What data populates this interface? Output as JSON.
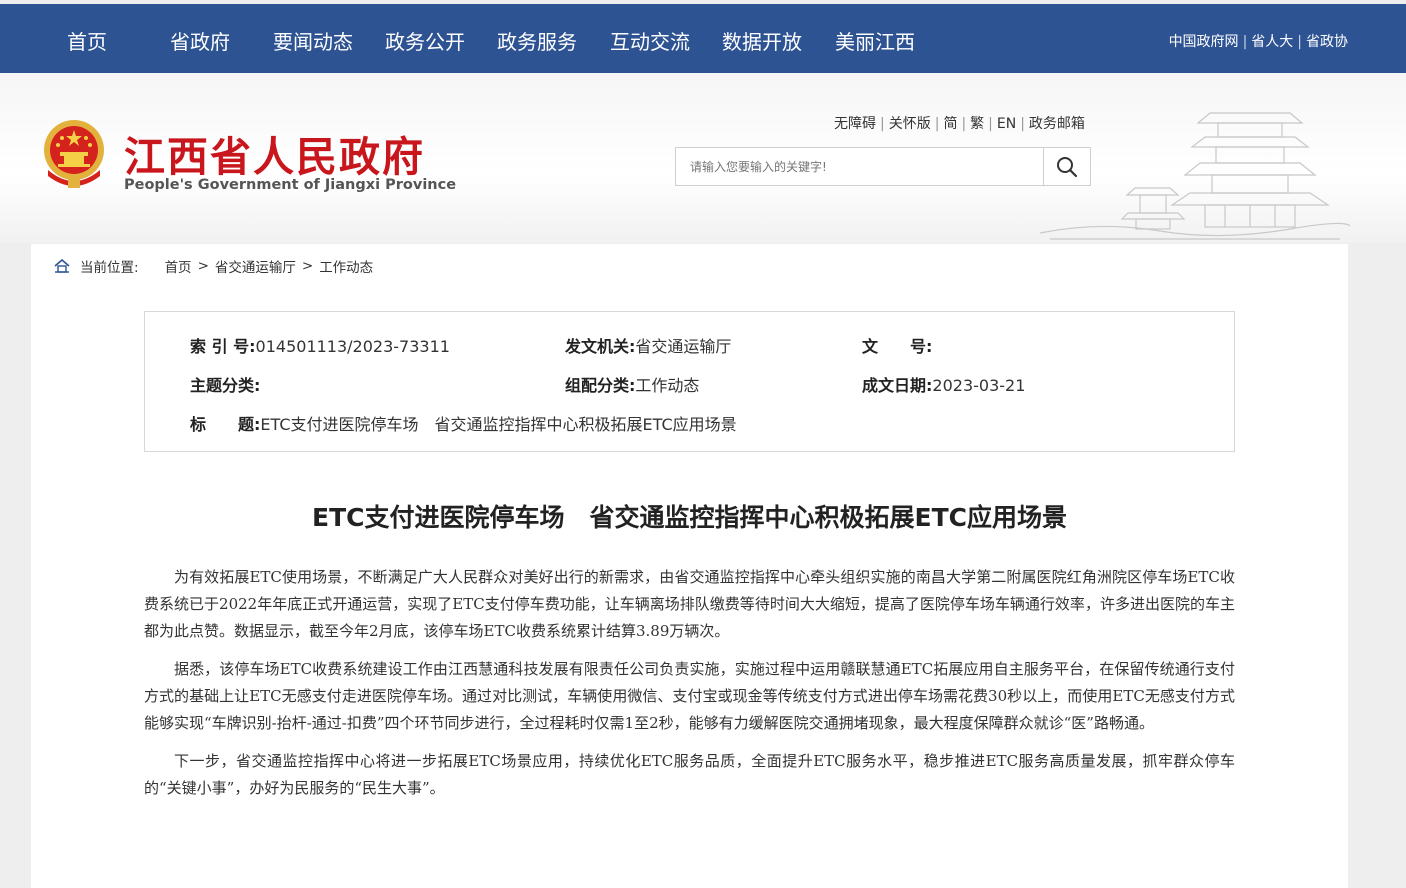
{
  "nav": {
    "items": [
      "首页",
      "省政府",
      "要闻动态",
      "政务公开",
      "政务服务",
      "互动交流",
      "数据开放",
      "美丽江西"
    ],
    "quick_links": [
      "中国政府网",
      "省人大",
      "省政协"
    ]
  },
  "header": {
    "logo_cn": "江西省人民政府",
    "logo_en": "People's Government of Jiangxi Province",
    "tools": [
      "无障碍",
      "关怀版",
      "简",
      "繁",
      "EN",
      "政务邮箱"
    ],
    "search_placeholder": "请输入您要输入的关键字!"
  },
  "breadcrumb": {
    "label": "当前位置:",
    "items": [
      "首页",
      "省交通运输厅",
      "工作动态"
    ],
    "separator": ">"
  },
  "meta": {
    "index_key": "索 引 号:",
    "index_val": "014501113/2023-73311",
    "issuer_key": "发文机关:",
    "issuer_val": "省交通运输厅",
    "docno_key": "文　　号:",
    "docno_val": "",
    "topic_key": "主题分类:",
    "topic_val": "",
    "category_key": "组配分类:",
    "category_val": "工作动态",
    "date_key": "成文日期:",
    "date_val": "2023-03-21",
    "title_key": "标　　题:",
    "title_val": "ETC支付进医院停车场　省交通监控指挥中心积极拓展ETC应用场景"
  },
  "article": {
    "title": "ETC支付进医院停车场　省交通监控指挥中心积极拓展ETC应用场景",
    "paragraphs": [
      "为有效拓展ETC使用场景，不断满足广大人民群众对美好出行的新需求，由省交通监控指挥中心牵头组织实施的南昌大学第二附属医院红角洲院区停车场ETC收费系统已于2022年年底正式开通运营，实现了ETC支付停车费功能，让车辆离场排队缴费等待时间大大缩短，提高了医院停车场车辆通行效率，许多进出医院的车主都为此点赞。数据显示，截至今年2月底，该停车场ETC收费系统累计结算3.89万辆次。",
      "据悉，该停车场ETC收费系统建设工作由江西慧通科技发展有限责任公司负责实施，实施过程中运用赣联慧通ETC拓展应用自主服务平台，在保留传统通行支付方式的基础上让ETC无感支付走进医院停车场。通过对比测试，车辆使用微信、支付宝或现金等传统支付方式进出停车场需花费30秒以上，而使用ETC无感支付方式能够实现“车牌识别-抬杆-通过-扣费”四个环节同步进行，全过程耗时仅需1至2秒，能够有力缓解医院交通拥堵现象，最大程度保障群众就诊“医”路畅通。",
      "下一步，省交通监控指挥中心将进一步拓展ETC场景应用，持续优化ETC服务品质，全面提升ETC服务水平，稳步推进ETC服务高质量发展，抓牢群众停车的“关键小事”，办好为民服务的“民生大事”。"
    ]
  },
  "colors": {
    "nav_bg": "#2d5393",
    "logo_red": "#c9161c",
    "emblem_gold": "#e3b23c"
  },
  "icons": {
    "search": "search-icon",
    "home": "home-icon",
    "emblem": "national-emblem-icon",
    "tower": "tengwang-pavilion-illustration"
  }
}
